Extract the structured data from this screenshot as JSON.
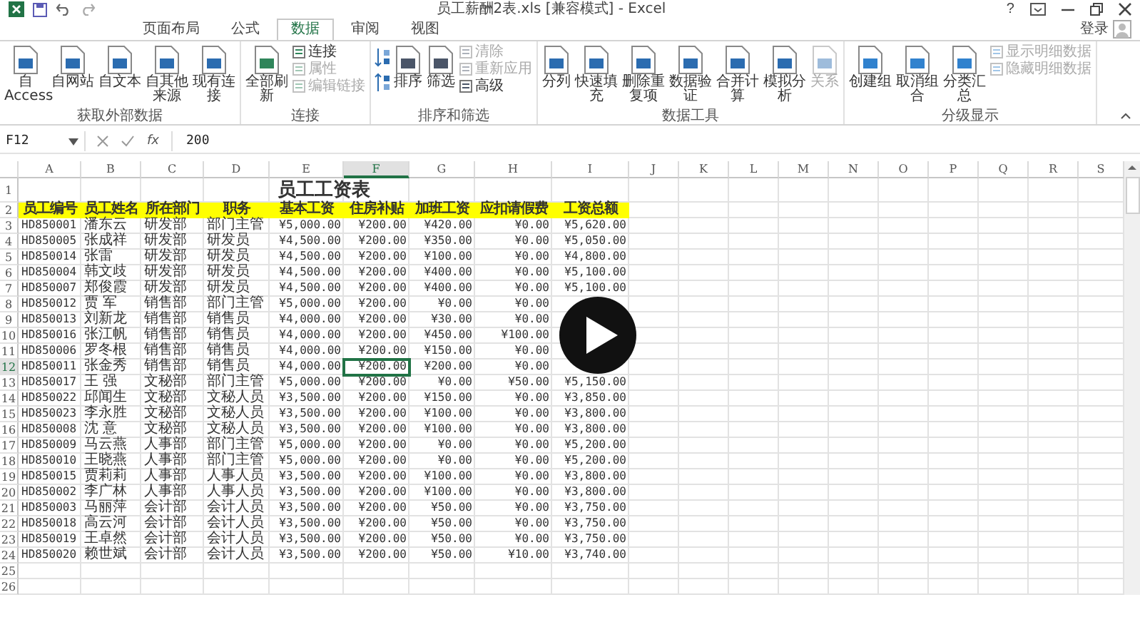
{
  "window": {
    "title": "员工薪酬2表.xls  [兼容模式] - Excel",
    "help": "?",
    "account": "登录"
  },
  "ribbon": {
    "tabs": [
      {
        "label": "页面布局",
        "selected": false
      },
      {
        "label": "公式",
        "selected": false
      },
      {
        "label": "数据",
        "selected": true
      },
      {
        "label": "审阅",
        "selected": false
      },
      {
        "label": "视图",
        "selected": false
      }
    ],
    "groups": [
      {
        "label": "获取外部数据",
        "items": [
          {
            "kind": "large",
            "label": "自 Access",
            "disabled": false
          },
          {
            "kind": "large",
            "label": "自网站",
            "disabled": false
          },
          {
            "kind": "large",
            "label": "自文本",
            "disabled": false
          },
          {
            "kind": "large",
            "label": "自其他来源",
            "disabled": false
          },
          {
            "kind": "large",
            "label": "现有连接",
            "disabled": false
          }
        ]
      },
      {
        "label": "连接",
        "items": [
          {
            "kind": "large",
            "label": "全部刷新",
            "disabled": false
          },
          {
            "kind": "stack",
            "items": [
              {
                "label": "连接",
                "disabled": false
              },
              {
                "label": "属性",
                "disabled": true
              },
              {
                "label": "编辑链接",
                "disabled": true
              }
            ]
          }
        ]
      },
      {
        "label": "排序和筛选",
        "items": [
          {
            "kind": "sort_icons"
          },
          {
            "kind": "large",
            "label": "排序",
            "disabled": false
          },
          {
            "kind": "large",
            "label": "筛选",
            "disabled": false
          },
          {
            "kind": "stack",
            "items": [
              {
                "label": "清除",
                "disabled": true
              },
              {
                "label": "重新应用",
                "disabled": true
              },
              {
                "label": "高级",
                "disabled": false
              }
            ]
          }
        ]
      },
      {
        "label": "数据工具",
        "items": [
          {
            "kind": "large",
            "label": "分列",
            "disabled": false
          },
          {
            "kind": "large",
            "label": "快速填充",
            "disabled": false
          },
          {
            "kind": "large",
            "label": "删除重复项",
            "disabled": false
          },
          {
            "kind": "large",
            "label": "数据验证",
            "disabled": false
          },
          {
            "kind": "large",
            "label": "合并计算",
            "disabled": false
          },
          {
            "kind": "large",
            "label": "模拟分析",
            "disabled": false
          },
          {
            "kind": "large",
            "label": "关系",
            "disabled": true
          }
        ]
      },
      {
        "label": "分级显示",
        "items": [
          {
            "kind": "large",
            "label": "创建组",
            "disabled": false
          },
          {
            "kind": "large",
            "label": "取消组合",
            "disabled": false
          },
          {
            "kind": "large",
            "label": "分类汇总",
            "disabled": false
          },
          {
            "kind": "stack",
            "items": [
              {
                "label": "显示明细数据",
                "disabled": true
              },
              {
                "label": "隐藏明细数据",
                "disabled": true
              }
            ]
          }
        ]
      }
    ]
  },
  "formula_bar": {
    "name_box": "F12",
    "function_label": "fx",
    "value": "200"
  },
  "sheet": {
    "columns": [
      {
        "label": "A",
        "selected": false
      },
      {
        "label": "B",
        "selected": false
      },
      {
        "label": "C",
        "selected": false
      },
      {
        "label": "D",
        "selected": false
      },
      {
        "label": "E",
        "selected": false
      },
      {
        "label": "F",
        "selected": true
      },
      {
        "label": "G",
        "selected": false
      },
      {
        "label": "H",
        "selected": false
      },
      {
        "label": "I",
        "selected": false
      },
      {
        "label": "J",
        "selected": false
      },
      {
        "label": "K",
        "selected": false
      },
      {
        "label": "L",
        "selected": false
      },
      {
        "label": "M",
        "selected": false
      },
      {
        "label": "N",
        "selected": false
      },
      {
        "label": "O",
        "selected": false
      },
      {
        "label": "P",
        "selected": false
      },
      {
        "label": "Q",
        "selected": false
      },
      {
        "label": "R",
        "selected": false
      },
      {
        "label": "S",
        "selected": false
      }
    ],
    "rows": [
      {
        "number": "1",
        "kind": "title",
        "selected": false,
        "title": "员工工资表"
      },
      {
        "number": "2",
        "kind": "header",
        "selected": false,
        "cells": [
          "员工编号",
          "员工姓名",
          "所在部门",
          "职务",
          "基本工资",
          "住房补贴",
          "加班工资",
          "应扣请假费",
          "工资总额"
        ]
      },
      {
        "number": "3",
        "kind": "data",
        "selected": false,
        "cells": [
          "HD850001",
          "潘东云",
          "研发部",
          "部门主管",
          "¥5,000.00",
          "¥200.00",
          "¥420.00",
          "¥0.00",
          "¥5,620.00"
        ]
      },
      {
        "number": "4",
        "kind": "data",
        "selected": false,
        "cells": [
          "HD850005",
          "张成祥",
          "研发部",
          "研发员",
          "¥4,500.00",
          "¥200.00",
          "¥350.00",
          "¥0.00",
          "¥5,050.00"
        ]
      },
      {
        "number": "5",
        "kind": "data",
        "selected": false,
        "cells": [
          "HD850014",
          "张雷",
          "研发部",
          "研发员",
          "¥4,500.00",
          "¥200.00",
          "¥100.00",
          "¥0.00",
          "¥4,800.00"
        ]
      },
      {
        "number": "6",
        "kind": "data",
        "selected": false,
        "cells": [
          "HD850004",
          "韩文歧",
          "研发部",
          "研发员",
          "¥4,500.00",
          "¥200.00",
          "¥400.00",
          "¥0.00",
          "¥5,100.00"
        ]
      },
      {
        "number": "7",
        "kind": "data",
        "selected": false,
        "cells": [
          "HD850007",
          "郑俊霞",
          "研发部",
          "研发员",
          "¥4,500.00",
          "¥200.00",
          "¥400.00",
          "¥0.00",
          "¥5,100.00"
        ]
      },
      {
        "number": "8",
        "kind": "data",
        "selected": false,
        "cells": [
          "HD850012",
          "贾  军",
          "销售部",
          "部门主管",
          "¥5,000.00",
          "¥200.00",
          "¥0.00",
          "¥0.00"
        ]
      },
      {
        "number": "9",
        "kind": "data",
        "selected": false,
        "cells": [
          "HD850013",
          "刘新龙",
          "销售部",
          "销售员",
          "¥4,000.00",
          "¥200.00",
          "¥30.00",
          "¥0.00"
        ]
      },
      {
        "number": "10",
        "kind": "data",
        "selected": false,
        "cells": [
          "HD850016",
          "张江帆",
          "销售部",
          "销售员",
          "¥4,000.00",
          "¥200.00",
          "¥450.00",
          "¥100.00"
        ]
      },
      {
        "number": "11",
        "kind": "data",
        "selected": false,
        "cells": [
          "HD850006",
          "罗冬根",
          "销售部",
          "销售员",
          "¥4,000.00",
          "¥200.00",
          "¥150.00",
          "¥0.00"
        ]
      },
      {
        "number": "12",
        "kind": "data",
        "selected": true,
        "cells": [
          "HD850011",
          "张金秀",
          "销售部",
          "销售员",
          "¥4,000.00",
          "¥200.00",
          "¥200.00",
          "¥0.00"
        ]
      },
      {
        "number": "13",
        "kind": "data",
        "selected": false,
        "cells": [
          "HD850017",
          "王  强",
          "文秘部",
          "部门主管",
          "¥5,000.00",
          "¥200.00",
          "¥0.00",
          "¥50.00",
          "¥5,150.00"
        ]
      },
      {
        "number": "14",
        "kind": "data",
        "selected": false,
        "cells": [
          "HD850022",
          "邱闻生",
          "文秘部",
          "文秘人员",
          "¥3,500.00",
          "¥200.00",
          "¥150.00",
          "¥0.00",
          "¥3,850.00"
        ]
      },
      {
        "number": "15",
        "kind": "data",
        "selected": false,
        "cells": [
          "HD850023",
          "李永胜",
          "文秘部",
          "文秘人员",
          "¥3,500.00",
          "¥200.00",
          "¥100.00",
          "¥0.00",
          "¥3,800.00"
        ]
      },
      {
        "number": "16",
        "kind": "data",
        "selected": false,
        "cells": [
          "HD850008",
          "沈  意",
          "文秘部",
          "文秘人员",
          "¥3,500.00",
          "¥200.00",
          "¥100.00",
          "¥0.00",
          "¥3,800.00"
        ]
      },
      {
        "number": "17",
        "kind": "data",
        "selected": false,
        "cells": [
          "HD850009",
          "马云燕",
          "人事部",
          "部门主管",
          "¥5,000.00",
          "¥200.00",
          "¥0.00",
          "¥0.00",
          "¥5,200.00"
        ]
      },
      {
        "number": "18",
        "kind": "data",
        "selected": false,
        "cells": [
          "HD850010",
          "王晓燕",
          "人事部",
          "部门主管",
          "¥5,000.00",
          "¥200.00",
          "¥0.00",
          "¥0.00",
          "¥5,200.00"
        ]
      },
      {
        "number": "19",
        "kind": "data",
        "selected": false,
        "cells": [
          "HD850015",
          "贾莉莉",
          "人事部",
          "人事人员",
          "¥3,500.00",
          "¥200.00",
          "¥100.00",
          "¥0.00",
          "¥3,800.00"
        ]
      },
      {
        "number": "20",
        "kind": "data",
        "selected": false,
        "cells": [
          "HD850002",
          "李广林",
          "人事部",
          "人事人员",
          "¥3,500.00",
          "¥200.00",
          "¥100.00",
          "¥0.00",
          "¥3,800.00"
        ]
      },
      {
        "number": "21",
        "kind": "data",
        "selected": false,
        "cells": [
          "HD850003",
          "马丽萍",
          "会计部",
          "会计人员",
          "¥3,500.00",
          "¥200.00",
          "¥50.00",
          "¥0.00",
          "¥3,750.00"
        ]
      },
      {
        "number": "22",
        "kind": "data",
        "selected": false,
        "cells": [
          "HD850018",
          "高云河",
          "会计部",
          "会计人员",
          "¥3,500.00",
          "¥200.00",
          "¥50.00",
          "¥0.00",
          "¥3,750.00"
        ]
      },
      {
        "number": "23",
        "kind": "data",
        "selected": false,
        "cells": [
          "HD850019",
          "王卓然",
          "会计部",
          "会计人员",
          "¥3,500.00",
          "¥200.00",
          "¥50.00",
          "¥0.00",
          "¥3,750.00"
        ]
      },
      {
        "number": "24",
        "kind": "data",
        "selected": false,
        "cells": [
          "HD850020",
          "赖世斌",
          "会计部",
          "会计人员",
          "¥3,500.00",
          "¥200.00",
          "¥50.00",
          "¥10.00",
          "¥3,740.00"
        ]
      },
      {
        "number": "25",
        "kind": "empty",
        "selected": false
      },
      {
        "number": "26",
        "kind": "empty",
        "selected": false
      }
    ]
  }
}
